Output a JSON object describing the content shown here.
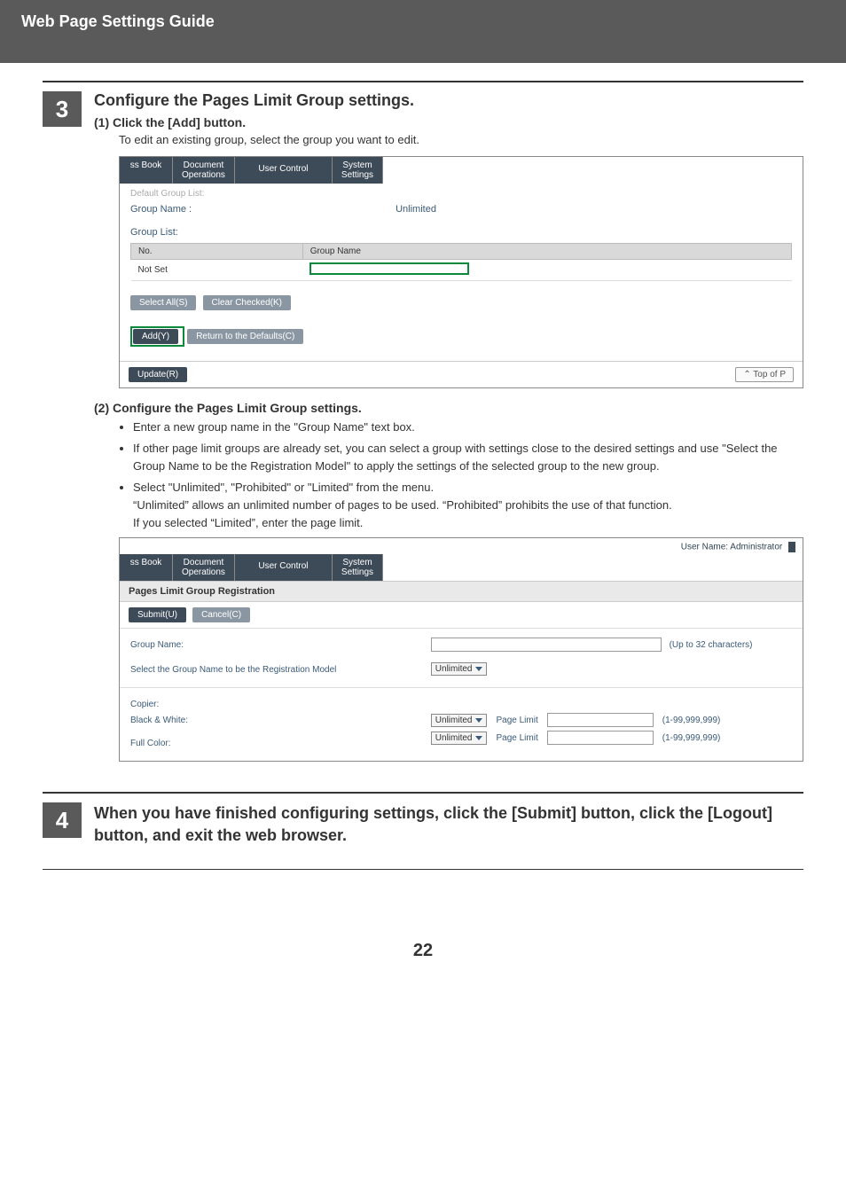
{
  "header": "Web Page Settings Guide",
  "page_number": "22",
  "step3": {
    "number": "3",
    "title": "Configure the Pages Limit Group settings.",
    "sub1_label": "(1)  Click the [Add] button.",
    "sub1_text": "To edit an existing group, select the group you want to edit.",
    "sub2_label": "(2)  Configure the Pages Limit Group settings.",
    "bullets": [
      "Enter a new group name in the \"Group Name\" text box.",
      "If other page limit groups are already set, you can select a group with settings close to the desired settings and use \"Select the Group Name to be the Registration Model\"  to apply the settings of the selected group to the new group.",
      "Select \"Unlimited\", \"Prohibited\" or \"Limited\" from the menu."
    ],
    "tail1": "“Unlimited” allows an unlimited number of pages to be used. “Prohibited” prohibits the use of that function.",
    "tail2": "If you selected “Limited”, enter the page limit."
  },
  "shot1": {
    "tabs": {
      "t1": "ss Book",
      "t2_l1": "Document",
      "t2_l2": "Operations",
      "t3": "User Control",
      "t4_l1": "System",
      "t4_l2": "Settings"
    },
    "default_group_list": "Default Group List:",
    "group_name_label": "Group Name :",
    "group_name_value": "Unlimited",
    "group_list": "Group List:",
    "col_no": "No.",
    "col_group_name": "Group Name",
    "not_set": "Not Set",
    "select_all": "Select All(S)",
    "clear_checked": "Clear Checked(K)",
    "add": "Add(Y)",
    "return_defaults": "Return to the Defaults(C)",
    "update": "Update(R)",
    "top_of_page": "⌃ Top of P"
  },
  "shot2": {
    "user_name": "User Name: Administrator",
    "tabs": {
      "t1": "ss Book",
      "t2_l1": "Document",
      "t2_l2": "Operations",
      "t3": "User Control",
      "t4_l1": "System",
      "t4_l2": "Settings"
    },
    "section": "Pages Limit Group Registration",
    "submit": "Submit(U)",
    "cancel": "Cancel(C)",
    "group_name": "Group Name:",
    "up_to": "(Up to 32 characters)",
    "select_model": "Select the Group Name to be the Registration Model",
    "unlimited": "Unlimited",
    "copier": "Copier:",
    "bw": "Black & White:",
    "full_color": "Full Color:",
    "page_limit": "Page Limit",
    "range": "(1-99,999,999)"
  },
  "step4": {
    "number": "4",
    "title": "When you have finished configuring settings, click the [Submit] button, click the [Logout] button, and exit the web browser."
  }
}
